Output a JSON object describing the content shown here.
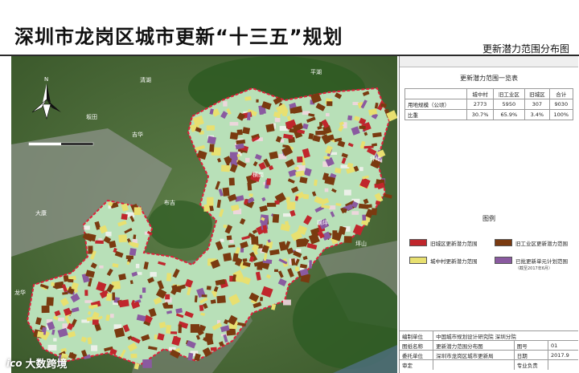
{
  "header": {
    "title": "深圳市龙岗区城市更新“十三五”规划",
    "subtitle": "更新潜力范围分布图"
  },
  "map": {
    "places": [
      "清湖",
      "坂田",
      "吉华",
      "大康",
      "龙华",
      "平湖",
      "横岗",
      "坪山",
      "布吉",
      "横坪",
      "坪地"
    ],
    "colors": {
      "old_city": "#c0262c",
      "old_industrial": "#7a3a10",
      "urban_village": "#e8e070",
      "approved_units": "#8a5aa0",
      "district_fill": "#b8e0b8",
      "district_outline": "#e0203a",
      "vegetation": "#3d6b2e"
    }
  },
  "summary_table": {
    "title": "更新潜力范围一览表",
    "headers": [
      "",
      "城中村",
      "旧工业区",
      "旧城区",
      "合计"
    ],
    "rows": [
      [
        "用地规模（公顷）",
        "2773",
        "5950",
        "307",
        "9030"
      ],
      [
        "比重",
        "30.7%",
        "65.9%",
        "3.4%",
        "100%"
      ]
    ]
  },
  "legend": {
    "title": "图例",
    "items": [
      {
        "label": "旧城区更新潜力范围",
        "color": "#c0262c"
      },
      {
        "label": "旧工业区更新潜力范围",
        "color": "#7a3a10"
      },
      {
        "label": "城中村更新潜力范围",
        "color": "#e8e070"
      },
      {
        "label": "已批更新单元计划范围",
        "color": "#8a5aa0",
        "note": "（截至2017年6月）"
      }
    ]
  },
  "info": {
    "rows": [
      [
        "编制单位",
        "中国城市规划设计研究院  深圳分院",
        "",
        ""
      ],
      [
        "图纸名称",
        "更新潜力范围分布图",
        "图号",
        "01"
      ],
      [
        "委托单位",
        "深圳市龙岗区城市更新局",
        "日期",
        "2017.9"
      ],
      [
        "审定",
        "",
        "专业负责",
        ""
      ]
    ]
  },
  "watermark": {
    "logo": "ico",
    "text": "大数跨境"
  }
}
